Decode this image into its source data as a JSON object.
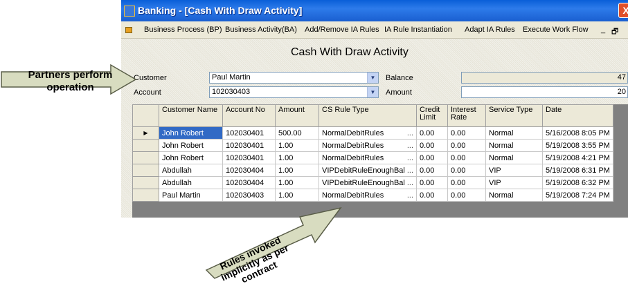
{
  "window": {
    "title": "Banking - [Cash With Draw Activity]",
    "close_glyph": "X"
  },
  "menu": {
    "items": [
      "Business Process (BP)",
      "Business Activity(BA)",
      "Add/Remove IA Rules",
      "IA Rule Instantiation",
      "Adapt IA Rules",
      "Execute Work Flow"
    ],
    "minimize_glyph": "_",
    "restore_glyph": "🗗"
  },
  "form": {
    "title": "Cash With Draw Activity",
    "customer_label": "Customer",
    "customer_value": "Paul Martin",
    "account_label": "Account",
    "account_value": "102030403",
    "balance_label": "Balance",
    "balance_value": "47",
    "amount_label": "Amount",
    "amount_value": "20"
  },
  "grid": {
    "columns": [
      "Customer Name",
      "Account No",
      "Amount",
      "CS Rule Type",
      "Credit Limit",
      "Interest Rate",
      "Service Type",
      "Date"
    ],
    "rows": [
      [
        "John Robert",
        "102030401",
        "500.00",
        "NormalDebitRules",
        "0.00",
        "0.00",
        "Normal",
        "5/16/2008 8:05 PM"
      ],
      [
        "John Robert",
        "102030401",
        "1.00",
        "NormalDebitRules",
        "0.00",
        "0.00",
        "Normal",
        "5/19/2008 3:55 PM"
      ],
      [
        "John Robert",
        "102030401",
        "1.00",
        "NormalDebitRules",
        "0.00",
        "0.00",
        "Normal",
        "5/19/2008 4:21 PM"
      ],
      [
        "Abdullah",
        "102030404",
        "1.00",
        "VIPDebitRuleEnoughBal",
        "0.00",
        "0.00",
        "VIP",
        "5/19/2008 6:31 PM"
      ],
      [
        "Abdullah",
        "102030404",
        "1.00",
        "VIPDebitRuleEnoughBal",
        "0.00",
        "0.00",
        "VIP",
        "5/19/2008 6:32 PM"
      ],
      [
        "Paul Martin",
        "102030403",
        "1.00",
        "NormalDebitRules",
        "0.00",
        "0.00",
        "Normal",
        "5/19/2008 7:24 PM"
      ]
    ],
    "cell_ellipsis": "..."
  },
  "annotations": {
    "partners_line1": "Partners perform",
    "partners_line2": "operation",
    "rules_line1": "Rules invoked",
    "rules_line2": "implicitly as per",
    "rules_line3": "contract"
  },
  "colors": {
    "titlebar": "#1a5fd0",
    "selection": "#316ac5",
    "arrow_fill": "#d8dcc0"
  }
}
